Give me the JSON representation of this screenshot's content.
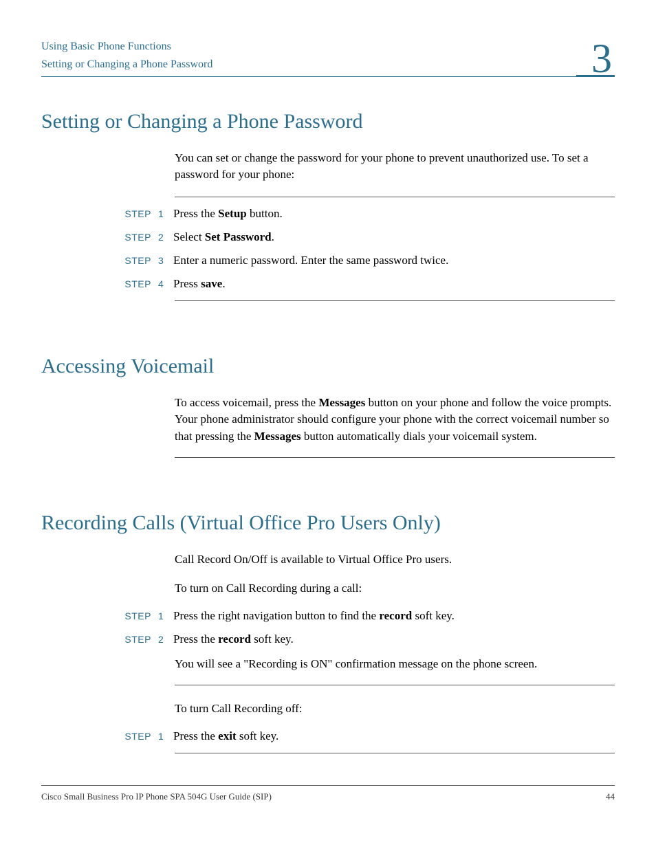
{
  "header": {
    "line1": "Using Basic Phone Functions",
    "line2": "Setting or Changing a Phone Password",
    "chapter": "3"
  },
  "section1": {
    "title": "Setting or Changing a Phone Password",
    "intro": "You can set or change the password for your phone to prevent unauthorized use. To set a password for your phone:",
    "steps": [
      {
        "label": "STEP",
        "num": "1",
        "pre": "Press the ",
        "bold": "Setup",
        "post": " button."
      },
      {
        "label": "STEP",
        "num": "2",
        "pre": "Select ",
        "bold": "Set Password",
        "post": "."
      },
      {
        "label": "STEP",
        "num": "3",
        "pre": "Enter a numeric password. Enter the same password twice.",
        "bold": "",
        "post": ""
      },
      {
        "label": "STEP",
        "num": "4",
        "pre": "Press ",
        "bold": "save",
        "post": "."
      }
    ]
  },
  "section2": {
    "title": "Accessing Voicemail",
    "para_pre": "To access voicemail, press the ",
    "para_b1": "Messages",
    "para_mid": " button on your phone and follow the voice prompts. Your phone administrator should configure your phone with the correct voicemail number so that pressing the ",
    "para_b2": "Messages",
    "para_post": " button automatically dials your voicemail system."
  },
  "section3": {
    "title": "Recording Calls (Virtual Office Pro Users Only)",
    "p1": "Call Record On/Off is available to Virtual Office Pro users.",
    "p2": "To turn on Call Recording during a call:",
    "stepsA": [
      {
        "label": "STEP",
        "num": "1",
        "pre": "Press the right navigation button to find the ",
        "bold": "record",
        "post": " soft key."
      },
      {
        "label": "STEP",
        "num": "2",
        "pre": "Press the ",
        "bold": "record",
        "post": " soft key."
      }
    ],
    "p3": "You will see a \"Recording is ON\" confirmation message on the phone screen.",
    "p4": "To turn Call Recording off:",
    "stepsB": [
      {
        "label": "STEP",
        "num": "1",
        "pre": "Press the ",
        "bold": "exit",
        "post": " soft key."
      }
    ]
  },
  "footer": {
    "left": "Cisco Small Business Pro IP Phone SPA 504G User Guide (SIP)",
    "right": "44"
  }
}
